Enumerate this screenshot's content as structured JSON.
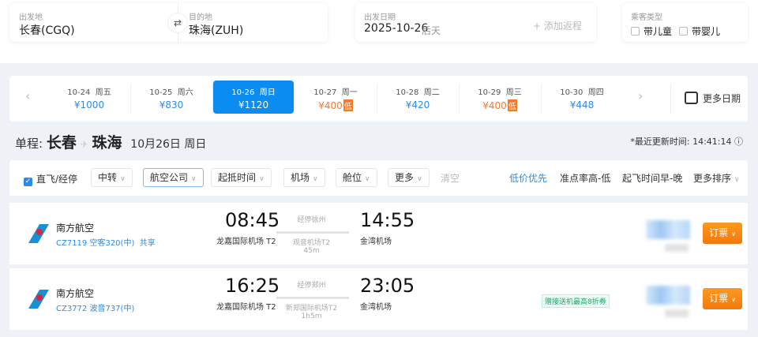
{
  "search": {
    "from_label": "出发地",
    "from_value": "长春(CGQ)",
    "to_label": "目的地",
    "to_value": "珠海(ZUH)",
    "date_label": "出发日期",
    "date_value": "2025-10-26",
    "date_hint": "后天",
    "add_return": "+ 添加返程",
    "passenger_label": "乘客类型",
    "child": "带儿童",
    "infant": "带婴儿"
  },
  "dates": [
    {
      "date": "10-24",
      "weekday": "周五",
      "price": "¥1000",
      "low": false
    },
    {
      "date": "10-25",
      "weekday": "周六",
      "price": "¥830",
      "low": false
    },
    {
      "date": "10-26",
      "weekday": "周日",
      "price": "¥1120",
      "low": false,
      "selected": true
    },
    {
      "date": "10-27",
      "weekday": "周一",
      "price": "¥400",
      "low": true
    },
    {
      "date": "10-28",
      "weekday": "周二",
      "price": "¥420",
      "low": false
    },
    {
      "date": "10-29",
      "weekday": "周三",
      "price": "¥400",
      "low": true
    },
    {
      "date": "10-30",
      "weekday": "周四",
      "price": "¥448",
      "low": false
    }
  ],
  "low_tag": "低",
  "more_dates": "更多日期",
  "title": {
    "prefix": "单程:",
    "from": "长春",
    "to": "珠海",
    "date": "10月26日 周日",
    "updated": "*最近更新时间: 14:41:14"
  },
  "filters": {
    "direct": "直飞/经停",
    "transfer": "中转",
    "airline": "航空公司",
    "time": "起抵时间",
    "airport": "机场",
    "cabin": "舱位",
    "more": "更多",
    "clear": "清空",
    "sort_price": "低价优先",
    "sort_ontime": "准点率高-低",
    "sort_time": "起飞时间早-晚",
    "sort_more": "更多排序"
  },
  "flights": [
    {
      "airline": "南方航空",
      "number": "CZ7119 空客320(中)",
      "share": "共享",
      "dep_time": "08:45",
      "dep_airport": "龙嘉国际机场 T2",
      "stop": "经停徐州",
      "stop_airport": "观音机场T2",
      "stop_duration": "45m",
      "arr_time": "14:55",
      "arr_airport": "金湾机场",
      "promo": "",
      "book": "订票"
    },
    {
      "airline": "南方航空",
      "number": "CZ3772 波音737(中)",
      "share": "",
      "dep_time": "16:25",
      "dep_airport": "龙嘉国际机场 T2",
      "stop": "经停郑州",
      "stop_airport": "新郑国际机场T2",
      "stop_duration": "1h5m",
      "arr_time": "23:05",
      "arr_airport": "金湾机场",
      "promo": "赠接送机最高8折券",
      "book": "订票"
    }
  ]
}
